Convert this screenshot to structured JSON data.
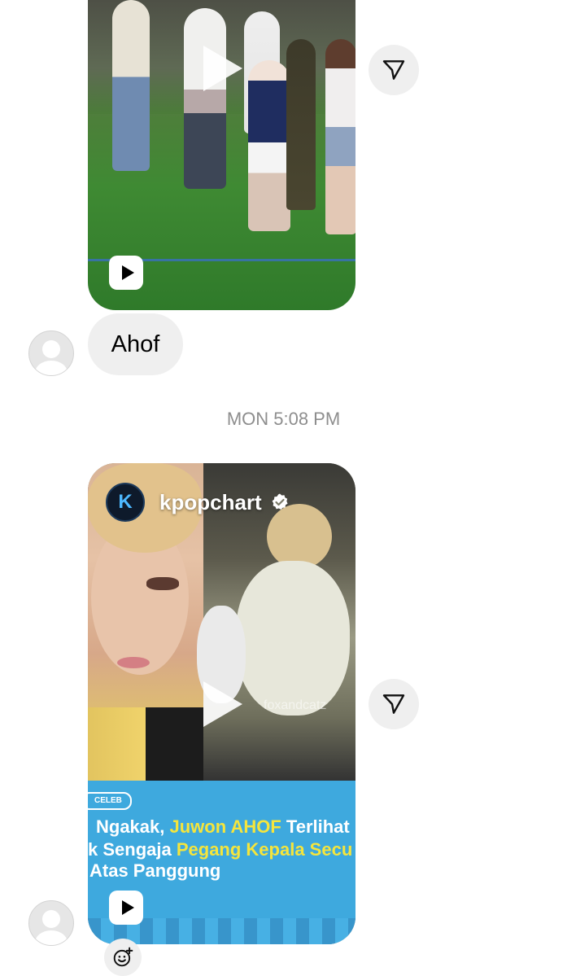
{
  "thread": {
    "message_text": "Ahof",
    "timestamp": "MON 5:08 PM"
  },
  "reel2": {
    "account_name": "kpopchart",
    "logo_letter": "K",
    "watermark": "foxandcatz",
    "tag": "CELEB",
    "headline": {
      "line1_a": "Ngakak, ",
      "line1_b": "Juwon AHOF",
      "line1_c": " Terlihat",
      "line2_a": "k Sengaja ",
      "line2_b": "Pegang Kepala Secu",
      "line3": "Atas Panggung"
    }
  },
  "icons": {
    "share": "paper-plane-icon",
    "reel": "reel-play-icon",
    "reaction": "add-reaction-icon"
  },
  "colors": {
    "bubble": "#efefef",
    "timestamp": "#8e8e8e",
    "headline_highlight": "#f5e53c",
    "band": "#3ea9de"
  }
}
